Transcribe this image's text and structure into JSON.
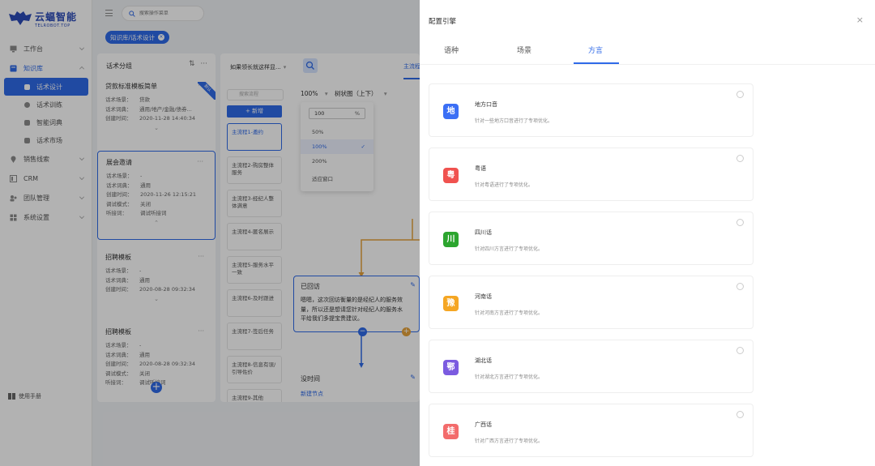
{
  "logo": {
    "name": "云蝠智能",
    "sub": "TELROBOT.TOP"
  },
  "sidebar": {
    "items": [
      {
        "label": "工作台"
      },
      {
        "label": "知识库"
      },
      {
        "label": "话术设计"
      },
      {
        "label": "话术训练"
      },
      {
        "label": "智能词典"
      },
      {
        "label": "话术市场"
      },
      {
        "label": "销售线索"
      },
      {
        "label": "CRM"
      },
      {
        "label": "团队管理"
      },
      {
        "label": "系统设置"
      }
    ],
    "manual": "使用手册"
  },
  "topbar": {
    "search_placeholder": "搜索操作菜单"
  },
  "breadcrumb_tab": "知识库/话术设计",
  "script_group": {
    "title": "话术分组",
    "badge": "默认",
    "cards": [
      {
        "title": "贷款标准模板简单",
        "scene": "贷款",
        "dict": "通用/地产/金融/债券...",
        "created": "2020-11-28 14:40:34"
      },
      {
        "title": "展会邀请",
        "scene": "-",
        "dict": "通用",
        "created": "2020-11-26 12:15:21",
        "mode": "关闭",
        "receiver": "调试听接词"
      },
      {
        "title": "招聘模板",
        "scene": "-",
        "dict": "通用",
        "created": "2020-08-28 09:32:34"
      },
      {
        "title": "招聘模板",
        "scene": "-",
        "dict": "通用",
        "created": "2020-08-28 09:32:34",
        "mode": "关闭",
        "receiver": "调试听接词"
      }
    ],
    "labels": {
      "scene": "话术场景：",
      "dict": "话术词典：",
      "created": "创建时间：",
      "mode": "调试模式：",
      "receiver": "听接词："
    }
  },
  "flow": {
    "select": "如果领长就这样显...",
    "tab": "主流程",
    "search_placeholder": "搜索流程",
    "add": "+  新增",
    "zoom": "100%",
    "layout": "树状图（上下）",
    "zoom_input": "100",
    "zoom_unit": "%",
    "zoom_options": [
      "50%",
      "100%",
      "200%",
      "适应窗口"
    ],
    "items": [
      "主流程1-邀约",
      "主流程2-购房整体服务",
      "主流程3-经纪人整体满意",
      "主流程4-匿名展示",
      "主流程5-服务水平一致",
      "主流程6-及时跟进",
      "主流程7-签后任务",
      "主流程8-信息有误/引导佐价",
      "主流程9-其他"
    ],
    "node1": {
      "title": "已回访",
      "lines": [
        "嗯嗯，这次回访衡量的是经纪人的服务效",
        "量，所以还是想请您针对经纪人的服务水",
        "平给我们多提宝贵建议。"
      ]
    },
    "node2": {
      "title": "没时间",
      "link": "新建节点"
    }
  },
  "drawer": {
    "title": "配置引擎",
    "tabs": [
      "语种",
      "场景",
      "方言"
    ],
    "active_tab": 2,
    "dialects": [
      {
        "icon": "地",
        "name": "地方口音",
        "desc": "针对一些地方口音进行了专项优化。",
        "color": "#3b6ff5"
      },
      {
        "icon": "粤",
        "name": "粤语",
        "desc": "针对粤语进行了专项优化。",
        "color": "#f0524f"
      },
      {
        "icon": "川",
        "name": "四川话",
        "desc": "针对四川方言进行了专项优化。",
        "color": "#2ca52f"
      },
      {
        "icon": "豫",
        "name": "河南话",
        "desc": "针对河南方言进行了专项优化。",
        "color": "#f5a623"
      },
      {
        "icon": "鄂",
        "name": "湖北话",
        "desc": "针对湖北方言进行了专项优化。",
        "color": "#7b5be0"
      },
      {
        "icon": "桂",
        "name": "广西话",
        "desc": "针对广西方言进行了专项优化。",
        "color": "#f36c6c"
      }
    ]
  },
  "colors": {
    "primary": "#2f6ae8",
    "accent_orange": "#e6a23c"
  }
}
